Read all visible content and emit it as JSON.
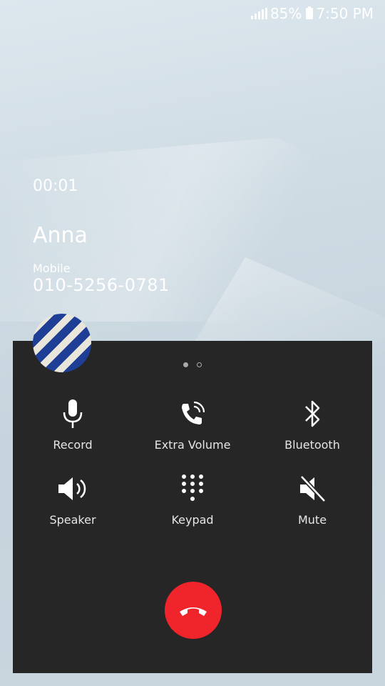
{
  "status_bar": {
    "battery": "85%",
    "time": "7:50 PM"
  },
  "call": {
    "timer": "00:01",
    "name": "Anna",
    "type": "Mobile",
    "number": "010-5256-0781"
  },
  "controls": [
    {
      "label": "Record",
      "icon": "microphone-icon"
    },
    {
      "label": "Extra Volume",
      "icon": "phone-volume-icon"
    },
    {
      "label": "Bluetooth",
      "icon": "bluetooth-icon"
    },
    {
      "label": "Speaker",
      "icon": "speaker-icon"
    },
    {
      "label": "Keypad",
      "icon": "keypad-icon"
    },
    {
      "label": "Mute",
      "icon": "mute-icon"
    }
  ],
  "colors": {
    "panel_bg": "#262626",
    "end_call": "#f0242b",
    "icon": "#ffffff"
  }
}
